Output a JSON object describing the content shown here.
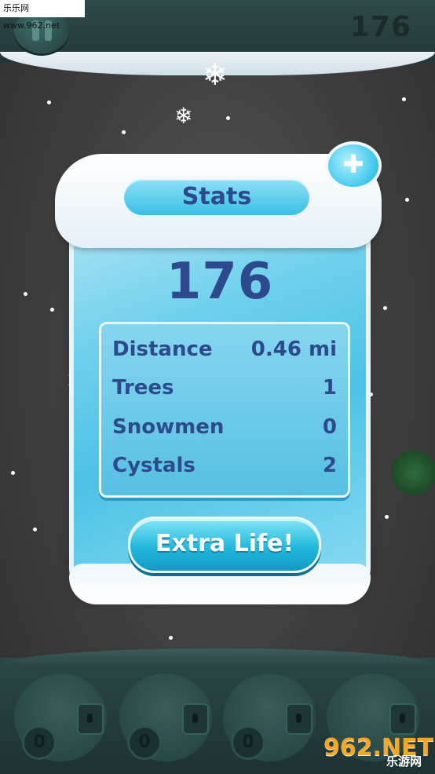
{
  "watermark_top": "乐乐网 www.962.net",
  "top": {
    "score": "176"
  },
  "stats": {
    "title": "Stats",
    "score": "176",
    "rows": [
      {
        "label": "Distance",
        "value": "0.46 mi"
      },
      {
        "label": "Trees",
        "value": "1"
      },
      {
        "label": "Snowmen",
        "value": "0"
      },
      {
        "label": "Cystals",
        "value": "2"
      }
    ],
    "button": "Extra Life!"
  },
  "slots": [
    "0",
    "0",
    "0"
  ],
  "watermark_bottom": {
    "brand": "962.NET",
    "sub": "乐游网"
  },
  "icons": [
    "pause-icon",
    "plus-icon",
    "snowflake-icon",
    "lock-icon"
  ]
}
